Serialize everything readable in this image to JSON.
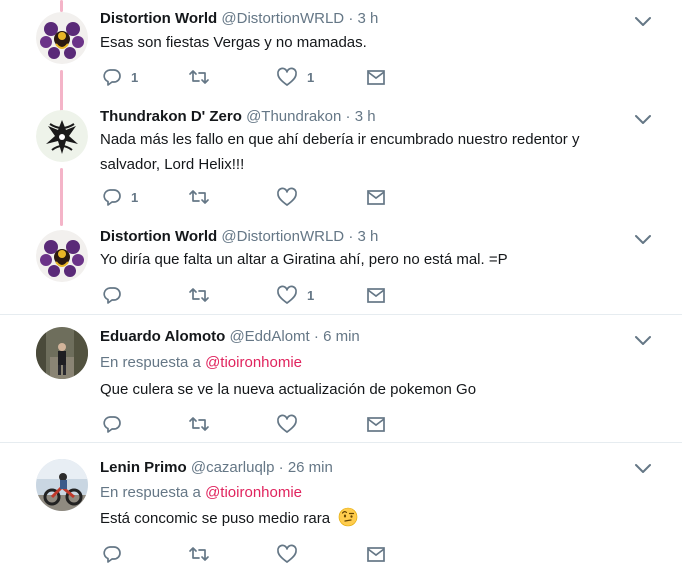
{
  "tweets": [
    {
      "name": "Distortion World",
      "handle": "@DistortionWRLD",
      "time": "3 h",
      "reply_prefix": "",
      "reply_mention": "",
      "text": "Esas son fiestas Vergas y no mamadas.",
      "text_line2": "",
      "reply_count": "1",
      "retweet_count": "",
      "like_count": "1"
    },
    {
      "name": "Thundrakon D' Zero",
      "handle": "@Thundrakon",
      "time": "3 h",
      "reply_prefix": "",
      "reply_mention": "",
      "text": "Nada más les fallo en que ahí debería ir encumbrado nuestro redentor y",
      "text_line2": "salvador, Lord Helix!!!",
      "reply_count": "1",
      "retweet_count": "",
      "like_count": ""
    },
    {
      "name": "Distortion World",
      "handle": "@DistortionWRLD",
      "time": "3 h",
      "reply_prefix": "",
      "reply_mention": "",
      "text": "Yo diría que falta un altar a Giratina ahí, pero no está mal. =P",
      "text_line2": "",
      "reply_count": "",
      "retweet_count": "",
      "like_count": "1"
    },
    {
      "name": "Eduardo Alomoto",
      "handle": "@EddAlomt",
      "time": "6 min",
      "reply_prefix": "En respuesta a",
      "reply_mention": "@tioironhomie",
      "text": "Que culera se ve la nueva actualización de pokemon Go",
      "text_line2": "",
      "reply_count": "",
      "retweet_count": "",
      "like_count": ""
    },
    {
      "name": "Lenin Primo",
      "handle": "@cazarluqlp",
      "time": "26 min",
      "reply_prefix": "En respuesta a",
      "reply_mention": "@tioironhomie",
      "text": "Está concomic se puso medio rara",
      "text_line2": "",
      "reply_count": "",
      "retweet_count": "",
      "like_count": ""
    }
  ],
  "separator": "·",
  "icons": {
    "reply": "reply-icon",
    "retweet": "retweet-icon",
    "like": "heart-icon",
    "dm": "envelope-icon",
    "more": "chevron-down-icon",
    "emoji": "raised-eyebrow-emoji"
  },
  "colors": {
    "thread_line": "#f4b4c8",
    "mention": "#e0245e",
    "icon": "#657786"
  }
}
